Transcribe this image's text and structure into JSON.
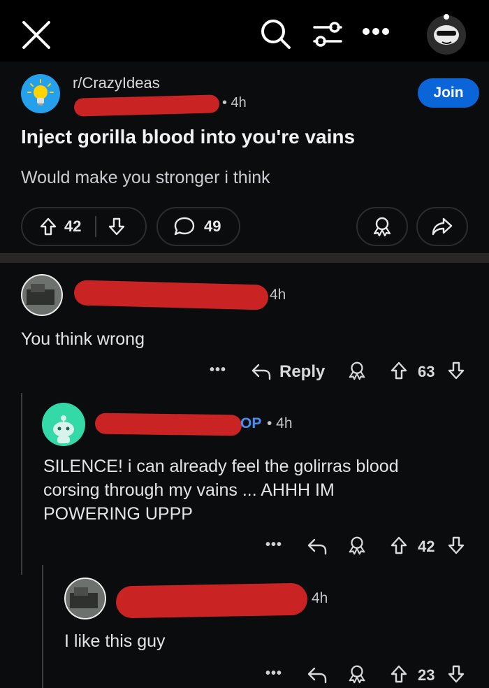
{
  "post": {
    "subreddit": "r/CrazyIdeas",
    "time": "• 4h",
    "join_label": "Join",
    "title": "Inject gorilla blood into you're vains",
    "body": "Would make you stronger i think",
    "upvotes": "42",
    "comments": "49"
  },
  "comments": [
    {
      "time": "4h",
      "text": "You think wrong",
      "reply_label": "Reply",
      "votes": "63"
    },
    {
      "badge": "OP",
      "time": "• 4h",
      "text_lines": [
        "SILENCE! i can already feel the golirras blood",
        "corsing through my vains ... AHHH IM",
        "POWERING UPPP"
      ],
      "votes": "42"
    },
    {
      "time": "4h",
      "text": "I like this guy",
      "votes": "23"
    }
  ],
  "colors": {
    "background": "#0b0c0e",
    "topbar": "#000000",
    "join": "#0a66d8",
    "redaction": "#c92323",
    "op_badge": "#4a8ff0"
  },
  "icons": [
    "close-icon",
    "search-icon",
    "filter-icon",
    "more-icon",
    "profile-avatar",
    "subreddit-icon",
    "upvote-icon",
    "downvote-icon",
    "comment-icon",
    "award-icon",
    "share-icon",
    "reply-icon"
  ]
}
